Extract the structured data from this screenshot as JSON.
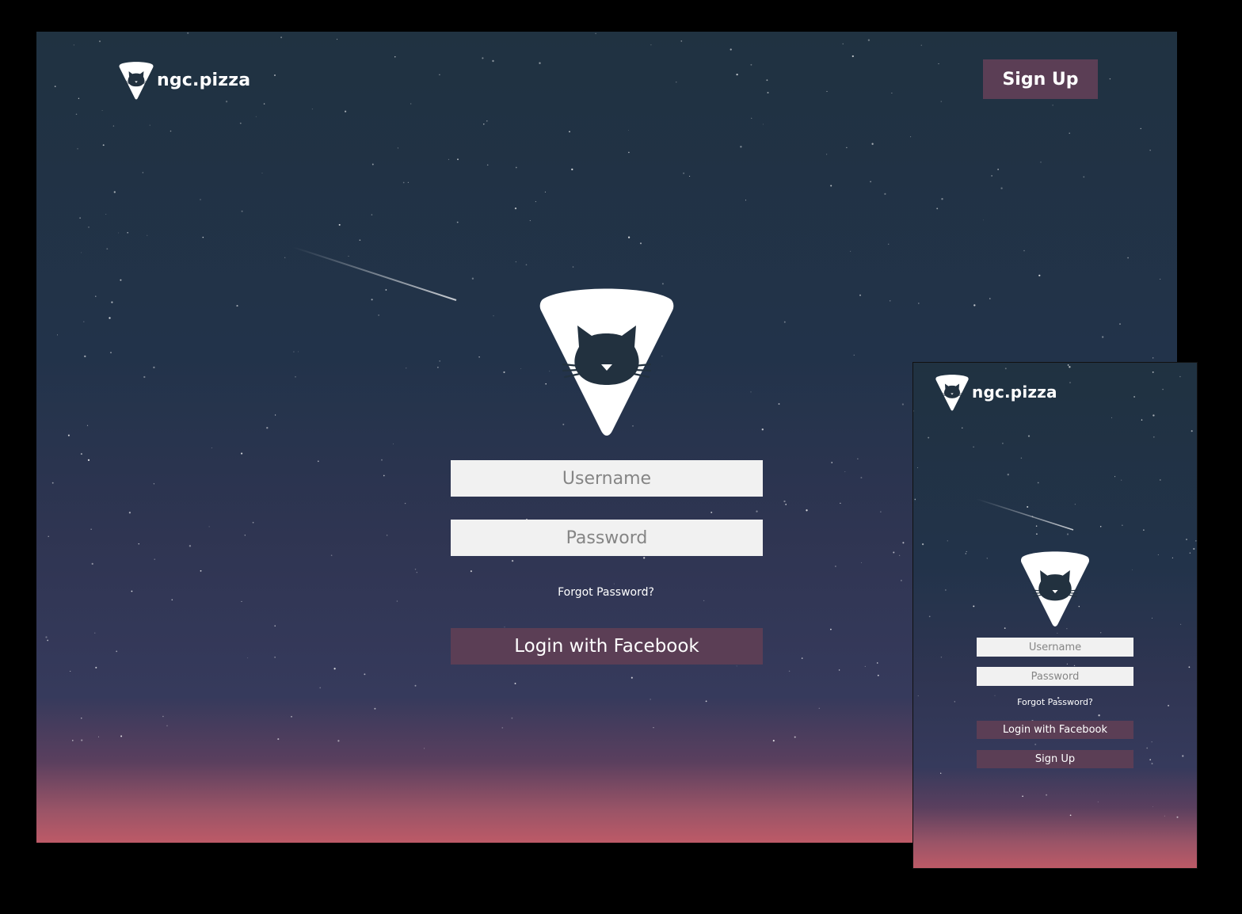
{
  "colors": {
    "button_bg": "#5b3e55",
    "input_bg": "#f1f1f1",
    "sky_top": "#203241",
    "sky_bottom": "#bd5a67"
  },
  "icons": {
    "logo": "cat-pizza-slice-icon"
  },
  "desktop": {
    "brand": {
      "name": "ngc.pizza"
    },
    "header": {
      "signup_label": "Sign Up"
    },
    "form": {
      "username_placeholder": "Username",
      "password_placeholder": "Password",
      "forgot_label": "Forgot Password?",
      "facebook_label": "Login with Facebook"
    }
  },
  "mobile": {
    "brand": {
      "name": "ngc.pizza"
    },
    "form": {
      "username_placeholder": "Username",
      "password_placeholder": "Password",
      "forgot_label": "Forgot Password?",
      "facebook_label": "Login with Facebook",
      "signup_label": "Sign Up"
    }
  }
}
